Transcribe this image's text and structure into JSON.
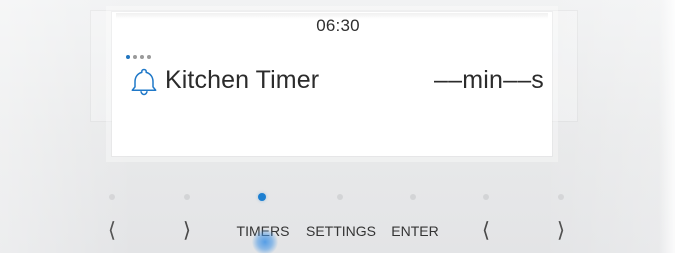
{
  "display": {
    "clock": "06:30",
    "page_indicator": {
      "count": 4,
      "active_index": 0
    },
    "timer": {
      "icon": "bell-icon",
      "name": "Kitchen Timer",
      "value": "––min––s"
    }
  },
  "controls": {
    "buttons": [
      {
        "id": "left-1",
        "label": "⟨",
        "icon": "chevron-left-icon"
      },
      {
        "id": "right-1",
        "label": "⟩",
        "icon": "chevron-right-icon"
      },
      {
        "id": "timers",
        "label": "TIMERS"
      },
      {
        "id": "settings",
        "label": "SETTINGS"
      },
      {
        "id": "enter",
        "label": "ENTER"
      },
      {
        "id": "left-2",
        "label": "⟨",
        "icon": "chevron-left-icon"
      },
      {
        "id": "right-2",
        "label": "⟩",
        "icon": "chevron-right-icon"
      }
    ],
    "active_button": "timers"
  },
  "colors": {
    "accent": "#1d7fd1",
    "text": "#2b2b2b",
    "indicator_inactive": "#d3d4d6",
    "screen": "#ffffff"
  }
}
